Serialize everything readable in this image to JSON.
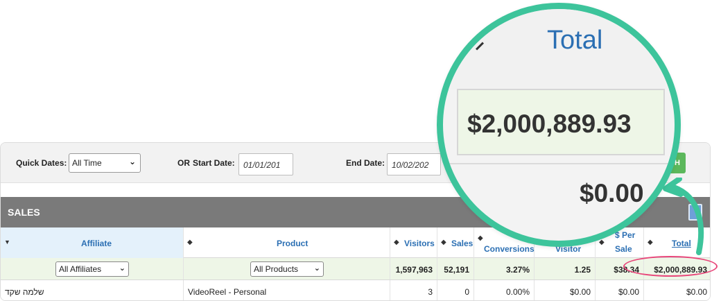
{
  "filters": {
    "quick_dates_label": "Quick Dates:",
    "quick_dates_value": "All Time",
    "or_label": "OR",
    "start_label": "Start Date:",
    "start_value": "01/01/201",
    "end_label": "End Date:",
    "end_value": "10/02/202",
    "submit_partial": "H"
  },
  "section": {
    "title": "SALES"
  },
  "table": {
    "headers": {
      "affiliate": "Affiliate",
      "product": "Product",
      "visitors": "Visitors",
      "sales": "Sales",
      "conversions": "Conversions",
      "per_visitor": "Visitor",
      "per_sale_1": "$ Per",
      "per_sale_2": "Sale",
      "total": "Total"
    },
    "filter_row": {
      "affiliate_select": "All Affiliates",
      "product_select": "All Products",
      "visitors": "1,597,963",
      "sales": "52,191",
      "conversions": "3.27%",
      "per_visitor": "1.25",
      "per_sale": "$38.34",
      "total": "$2,000,889.93"
    },
    "rows": [
      {
        "affiliate": "שלמה שקד",
        "product": "VideoReel - Personal",
        "visitors": "3",
        "sales": "0",
        "conversions": "0.00%",
        "per_visitor": "$0.00",
        "per_sale": "$0.00",
        "total": "$0.00"
      }
    ]
  },
  "callout": {
    "header": "Total",
    "amount": "$2,000,889.93",
    "zero": "$0.00",
    "ring_color": "#3dc49b",
    "highlight_color": "#e8467a"
  }
}
